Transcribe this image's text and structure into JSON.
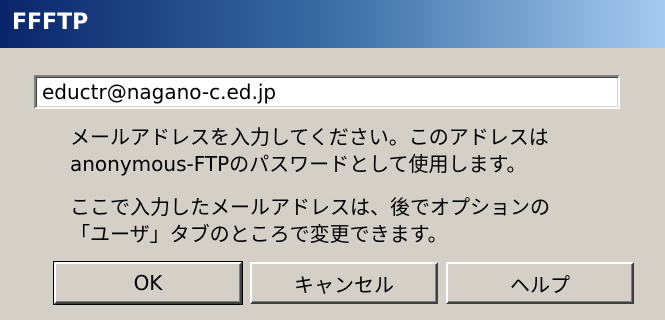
{
  "window": {
    "title": "FFFTP"
  },
  "email_field": {
    "value": "eductr@nagano-c.ed.jp"
  },
  "message": {
    "line1": "メールアドレスを入力してください。このアドレスは",
    "line2": "anonymous-FTPのパスワードとして使用します。",
    "line3": "ここで入力したメールアドレスは、後でオプションの",
    "line4": "「ユーザ」タブのところで変更できます。"
  },
  "buttons": {
    "ok": "OK",
    "cancel": "キャンセル",
    "help": "ヘルプ"
  }
}
